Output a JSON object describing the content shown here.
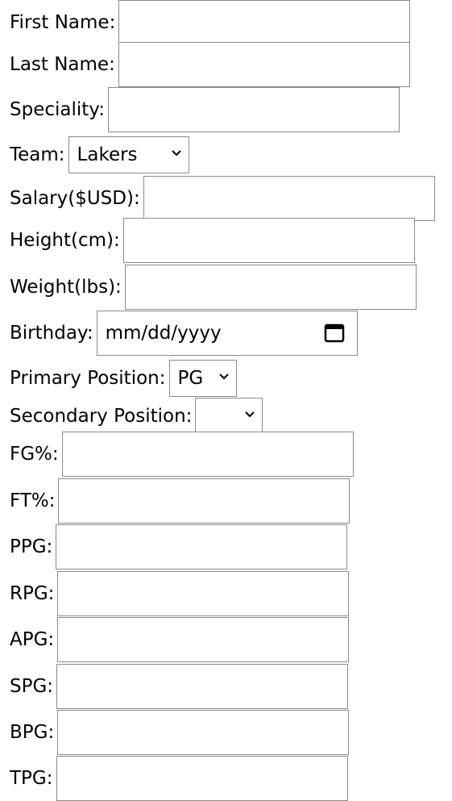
{
  "form": {
    "first_name": {
      "label": "First Name:",
      "value": ""
    },
    "last_name": {
      "label": "Last Name:",
      "value": ""
    },
    "speciality": {
      "label": "Speciality:",
      "value": ""
    },
    "team": {
      "label": "Team:",
      "selected": "Lakers"
    },
    "salary": {
      "label": "Salary($USD):",
      "value": ""
    },
    "height": {
      "label": "Height(cm):",
      "value": ""
    },
    "weight": {
      "label": "Weight(lbs):",
      "value": ""
    },
    "birthday": {
      "label": "Birthday:",
      "placeholder": "mm/dd/yyyy"
    },
    "primary_position": {
      "label": "Primary Position:",
      "selected": "PG"
    },
    "secondary_position": {
      "label": "Secondary Position:",
      "selected": ""
    },
    "fg_pct": {
      "label": "FG%:",
      "value": ""
    },
    "ft_pct": {
      "label": "FT%:",
      "value": ""
    },
    "ppg": {
      "label": "PPG:",
      "value": ""
    },
    "rpg": {
      "label": "RPG:",
      "value": ""
    },
    "apg": {
      "label": "APG:",
      "value": ""
    },
    "spg": {
      "label": "SPG:",
      "value": ""
    },
    "bpg": {
      "label": "BPG:",
      "value": ""
    },
    "tpg": {
      "label": "TPG:",
      "value": ""
    }
  },
  "icons": {
    "select_chevron": "chevron-down-icon",
    "date_picker": "calendar-icon"
  }
}
